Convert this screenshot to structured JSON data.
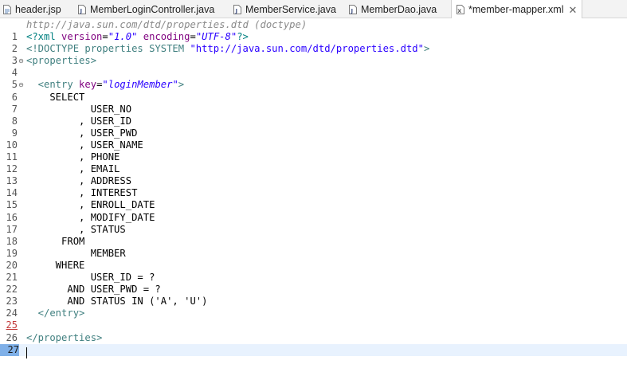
{
  "tabs": [
    {
      "label": "header.jsp",
      "icon": "jsp-file-icon",
      "active": false
    },
    {
      "label": "MemberLoginController.java",
      "icon": "java-file-icon",
      "active": false
    },
    {
      "label": "MemberService.java",
      "icon": "java-file-icon",
      "active": false
    },
    {
      "label": "MemberDao.java",
      "icon": "java-file-icon",
      "active": false
    },
    {
      "label": "*member-mapper.xml",
      "icon": "xml-file-icon",
      "active": true,
      "close": "✕"
    }
  ],
  "editor": {
    "doctype_hint": "http://java.sun.com/dtd/properties.dtd (doctype)",
    "current_line": 27,
    "line_numbers": [
      "1",
      "2",
      "3",
      "4",
      "5",
      "6",
      "7",
      "8",
      "9",
      "10",
      "11",
      "12",
      "13",
      "14",
      "15",
      "16",
      "17",
      "18",
      "19",
      "20",
      "21",
      "22",
      "23",
      "24",
      "25",
      "26",
      "27"
    ],
    "lines": {
      "l1_a": "<?xml ",
      "l1_b": "version",
      "l1_c": "=",
      "l1_d": "\"1.0\"",
      "l1_e": " encoding",
      "l1_f": "=",
      "l1_g": "\"UTF-8\"",
      "l1_h": "?>",
      "l2_a": "<!DOCTYPE properties SYSTEM ",
      "l2_b": "\"http://java.sun.com/dtd/properties.dtd\"",
      "l2_c": ">",
      "l3": "<properties>",
      "l5_a": "  <entry ",
      "l5_b": "key",
      "l5_c": "=",
      "l5_d": "\"loginMember\"",
      "l5_e": ">",
      "l6": "    SELECT",
      "l7": "           USER_NO",
      "l8": "         , USER_ID",
      "l9": "         , USER_PWD",
      "l10": "         , USER_NAME",
      "l11": "         , PHONE",
      "l12": "         , EMAIL",
      "l13": "         , ADDRESS",
      "l14": "         , INTEREST",
      "l15": "         , ENROLL_DATE",
      "l16": "         , MODIFY_DATE",
      "l17": "         , STATUS",
      "l18": "      FROM",
      "l19": "           MEMBER",
      "l20": "     WHERE",
      "l21": "           USER_ID = ?",
      "l22": "       AND USER_PWD = ?",
      "l23": "       AND STATUS IN ('A', 'U')",
      "l24": "  </entry>",
      "l26": "</properties>"
    },
    "fold_markers": {
      "l3": "⊖",
      "l5": "⊖"
    }
  },
  "colors": {
    "tag": "#3f7f7f",
    "attribute": "#7f007f",
    "value": "#2a00ff",
    "current_line_bg": "#e8f2fe"
  }
}
